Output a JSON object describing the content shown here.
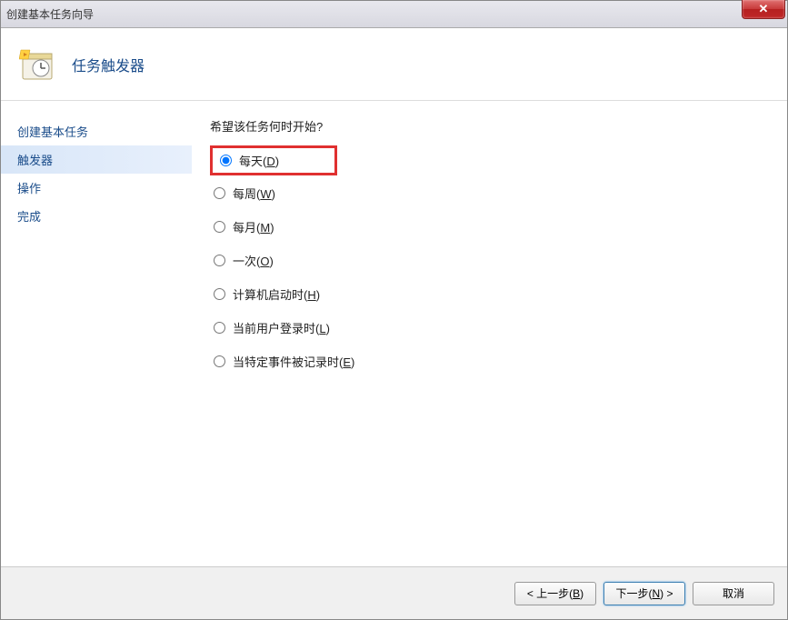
{
  "titlebar": {
    "title": "创建基本任务向导"
  },
  "header": {
    "title": "任务触发器"
  },
  "sidebar": {
    "items": [
      {
        "label": "创建基本任务",
        "active": false
      },
      {
        "label": "触发器",
        "active": true
      },
      {
        "label": "操作",
        "active": false
      },
      {
        "label": "完成",
        "active": false
      }
    ]
  },
  "main": {
    "question": "希望该任务何时开始?",
    "options": [
      {
        "label": "每天",
        "key": "D",
        "checked": true,
        "highlight": true
      },
      {
        "label": "每周",
        "key": "W",
        "checked": false,
        "highlight": false
      },
      {
        "label": "每月",
        "key": "M",
        "checked": false,
        "highlight": false
      },
      {
        "label": "一次",
        "key": "O",
        "checked": false,
        "highlight": false
      },
      {
        "label": "计算机启动时",
        "key": "H",
        "checked": false,
        "highlight": false
      },
      {
        "label": "当前用户登录时",
        "key": "L",
        "checked": false,
        "highlight": false
      },
      {
        "label": "当特定事件被记录时",
        "key": "E",
        "checked": false,
        "highlight": false
      }
    ]
  },
  "footer": {
    "back": "< 上一步",
    "back_key": "B",
    "next": "下一步",
    "next_key": "N",
    "next_suffix": " >",
    "cancel": "取消"
  }
}
